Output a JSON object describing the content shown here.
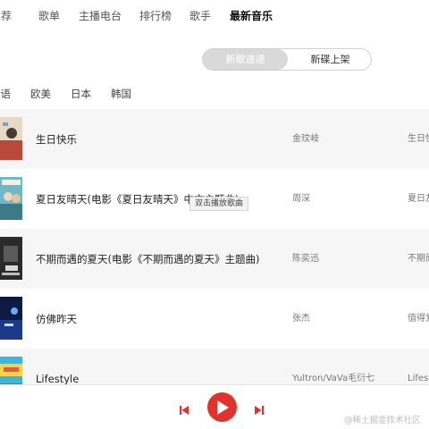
{
  "nav": {
    "items": [
      {
        "label": "推荐",
        "active": false
      },
      {
        "label": "歌单",
        "active": false
      },
      {
        "label": "主播电台",
        "active": false
      },
      {
        "label": "排行榜",
        "active": false
      },
      {
        "label": "歌手",
        "active": false
      },
      {
        "label": "最新音乐",
        "active": true
      }
    ]
  },
  "toggle": {
    "new_songs": "新歌速递",
    "new_albums": "新碟上架",
    "selected": "新歌速递"
  },
  "regions": [
    "华语",
    "欧美",
    "日本",
    "韩国"
  ],
  "songs": [
    {
      "title": "生日快乐",
      "artist": "金玟岐",
      "album": "生日快乐"
    },
    {
      "title": "夏日友晴天(电影《夏日友晴天》中文主题曲)",
      "artist": "周深",
      "album": "夏日友晴天"
    },
    {
      "title": "不期而遇的夏天(电影《不期而遇的夏天》主题曲)",
      "artist": "陈奕迅",
      "album": "不期而遇的夏天"
    },
    {
      "title": "仿佛昨天",
      "artist": "张杰",
      "album": "值得爱"
    },
    {
      "title": "Lifestyle",
      "artist": "Yultron/VaVa毛衍七",
      "album": "Lifestyle"
    }
  ],
  "tooltip": "双击播放歌曲",
  "watermark": "@稀土掘金技术社区",
  "colors": {
    "accent": "#e2322e",
    "toggle_active_bg": "#d9d9d9",
    "row_alt_bg": "#f6f6f6"
  },
  "player": {
    "prev_icon": "skip-back-icon",
    "play_icon": "play-icon",
    "next_icon": "skip-forward-icon"
  }
}
